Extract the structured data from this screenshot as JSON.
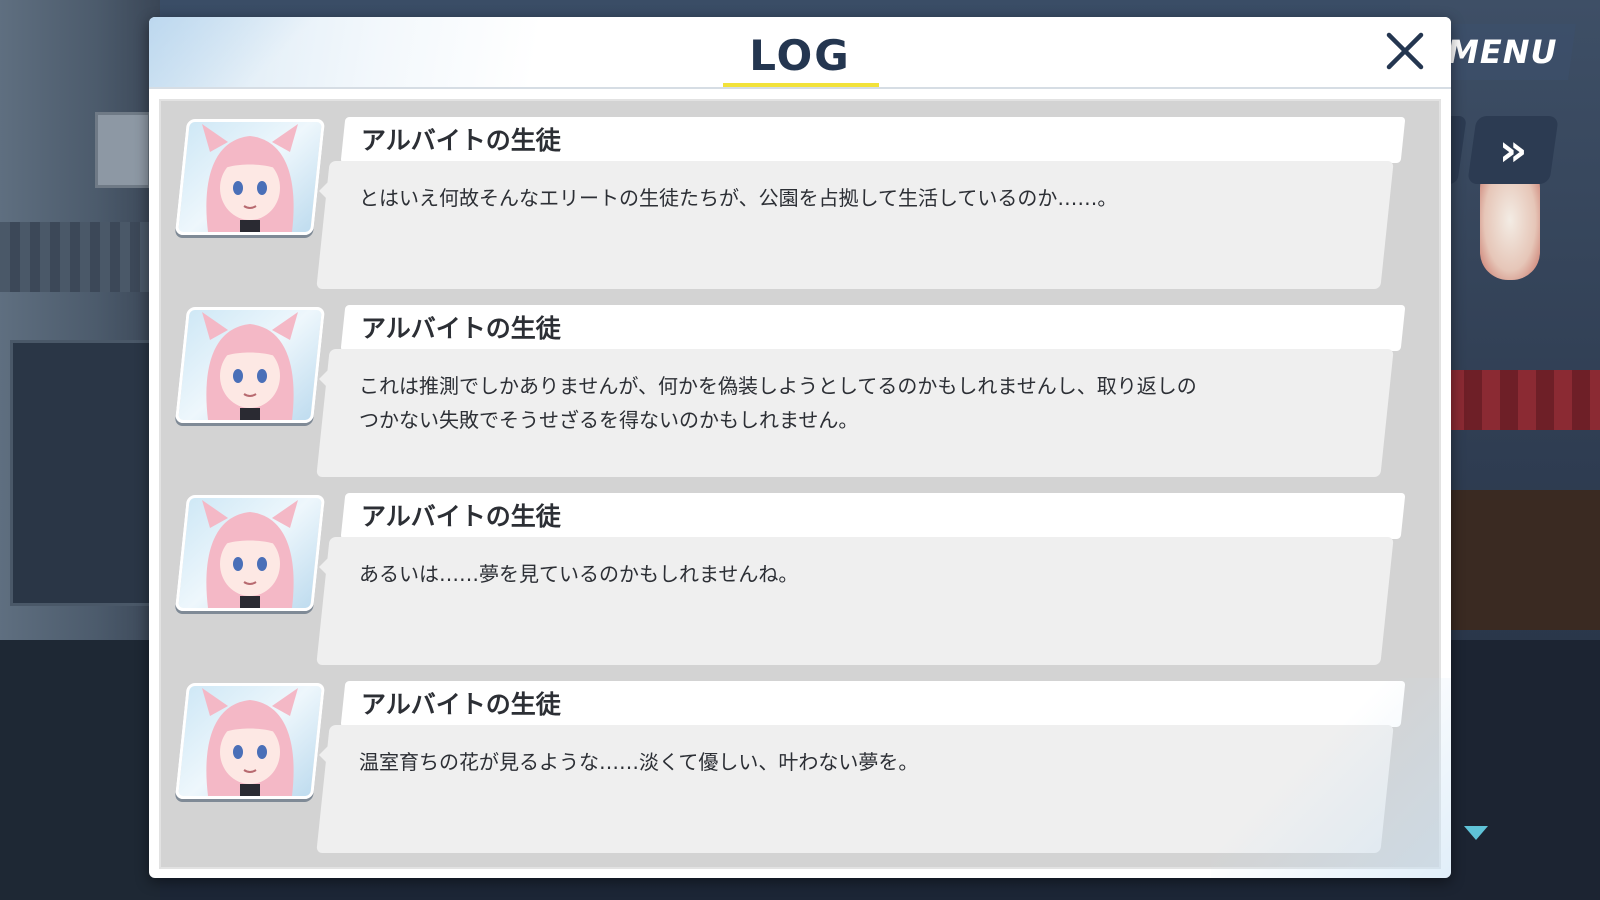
{
  "header": {
    "title": "LOG",
    "menu_label": "MENU",
    "skip_label": "»"
  },
  "colors": {
    "title": "#243650",
    "underline": "#f2e23a",
    "accent": "#5fc3d8"
  },
  "log_entries": [
    {
      "speaker": "アルバイトの生徒",
      "text": "とはいえ何故そんなエリートの生徒たちが、公園を占拠して生活しているのか……。"
    },
    {
      "speaker": "アルバイトの生徒",
      "text_line1": "これは推測でしかありませんが、何かを偽装しようとしてるのかもしれませんし、取り返しの",
      "text_line2": "つかない失敗でそうせざるを得ないのかもしれません。"
    },
    {
      "speaker": "アルバイトの生徒",
      "text": "あるいは……夢を見ているのかもしれませんね。"
    },
    {
      "speaker": "アルバイトの生徒",
      "text": "温室育ちの花が見るような……淡くて優しい、叶わない夢を。"
    }
  ],
  "icons": {
    "close": "close-icon",
    "scroll": "scroll-down-icon"
  }
}
